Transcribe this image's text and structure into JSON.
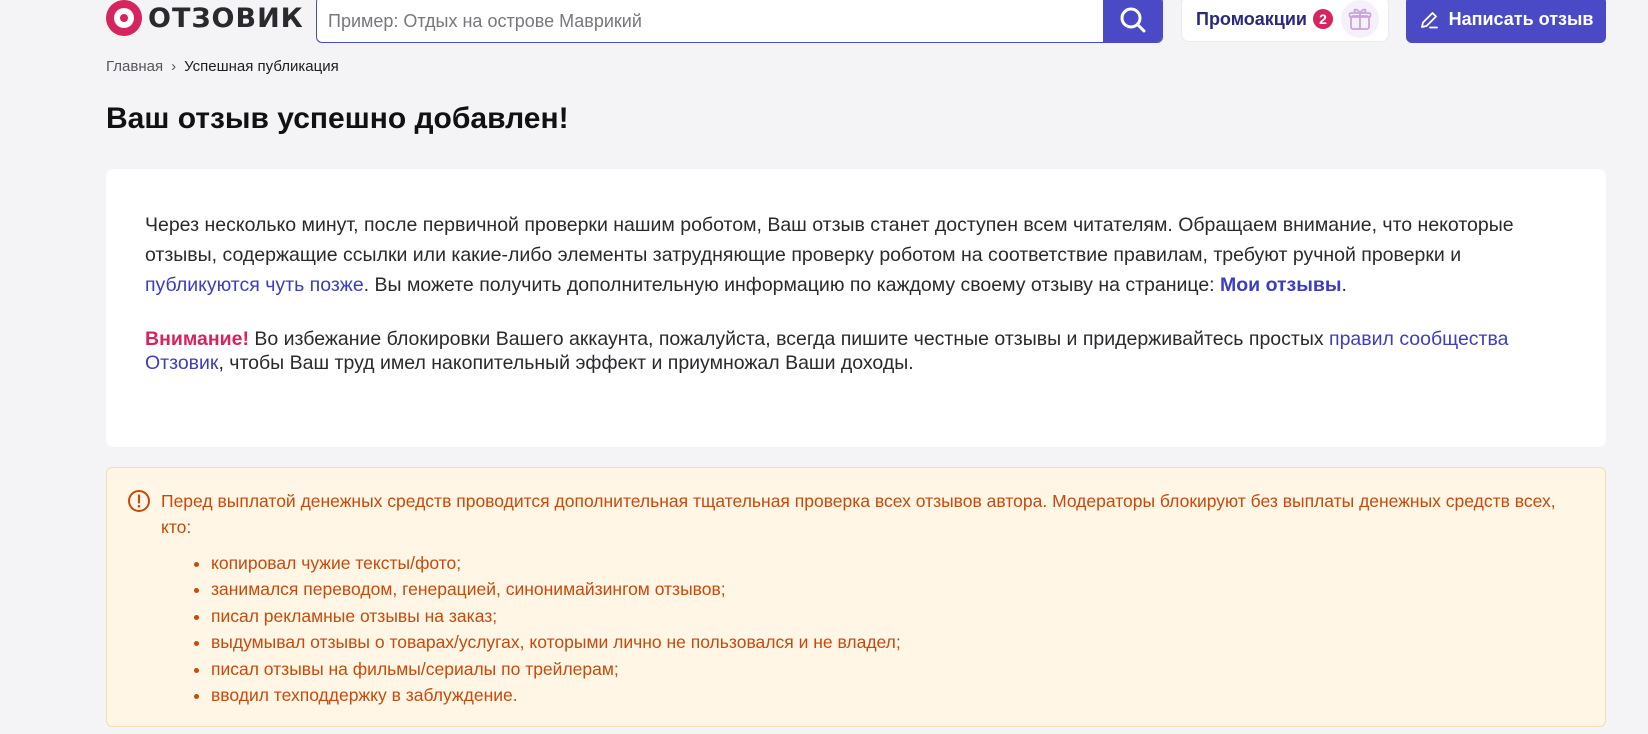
{
  "header": {
    "logo_text": "ОТЗОВИК",
    "search_placeholder": "Пример: Отдых на острове Маврикий",
    "promo_label": "Промоакции",
    "promo_count": "2",
    "write_label": "Написать отзыв"
  },
  "breadcrumb": {
    "home": "Главная",
    "separator": "›",
    "current": "Успешная публикация"
  },
  "page_title": "Ваш отзыв успешно добавлен!",
  "info": {
    "text_1": "Через несколько минут, после первичной проверки нашим роботом, Ваш отзыв станет доступен всем читателям. Обращаем внимание, что некоторые отзывы, содержащие ссылки или какие-либо элементы затрудняющие проверку роботом на соответствие правилам, требуют ручной проверки и ",
    "link_later": "публикуются чуть позже",
    "text_2": ". Вы можете получить дополнительную информацию по каждому своему отзыву на странице: ",
    "link_my_reviews": "Мои отзывы",
    "text_3": ".",
    "warn_label": "Внимание!",
    "warn_text_1": " Во избежание блокировки Вашего аккаунта, пожалуйста, всегда пишите честные отзывы и придерживайтесь простых ",
    "link_rules": "правил сообщества Отзовик",
    "warn_text_2": ", чтобы Ваш труд имел накопительный эффект и приумножал Ваши доходы."
  },
  "notice": {
    "lead": "Перед выплатой денежных средств проводится дополнительная тщательная проверка всех отзывов автора. Модераторы блокируют без выплаты денежных средств всех, кто:",
    "items": [
      "копировал чужие тексты/фото;",
      "занимался переводом, генерацией, синонимайзингом отзывов;",
      "писал рекламные отзывы на заказ;",
      "выдумывал отзывы о товарах/услугах, которыми лично не пользовался и не владел;",
      "писал отзывы на фильмы/сериалы по трейлерам;",
      "вводил техподдержку в заблуждение."
    ]
  },
  "colors": {
    "brand": "#d6245c",
    "accent": "#4a4ac6",
    "link": "#3d3dc0",
    "notice_text": "#c74a0c",
    "notice_bg": "#fff6e6"
  },
  "icons": {
    "logo": "otzovik-logo-icon",
    "search": "search-icon",
    "gift": "gift-icon",
    "write": "pencil-icon",
    "notice": "exclamation-circle-icon"
  }
}
